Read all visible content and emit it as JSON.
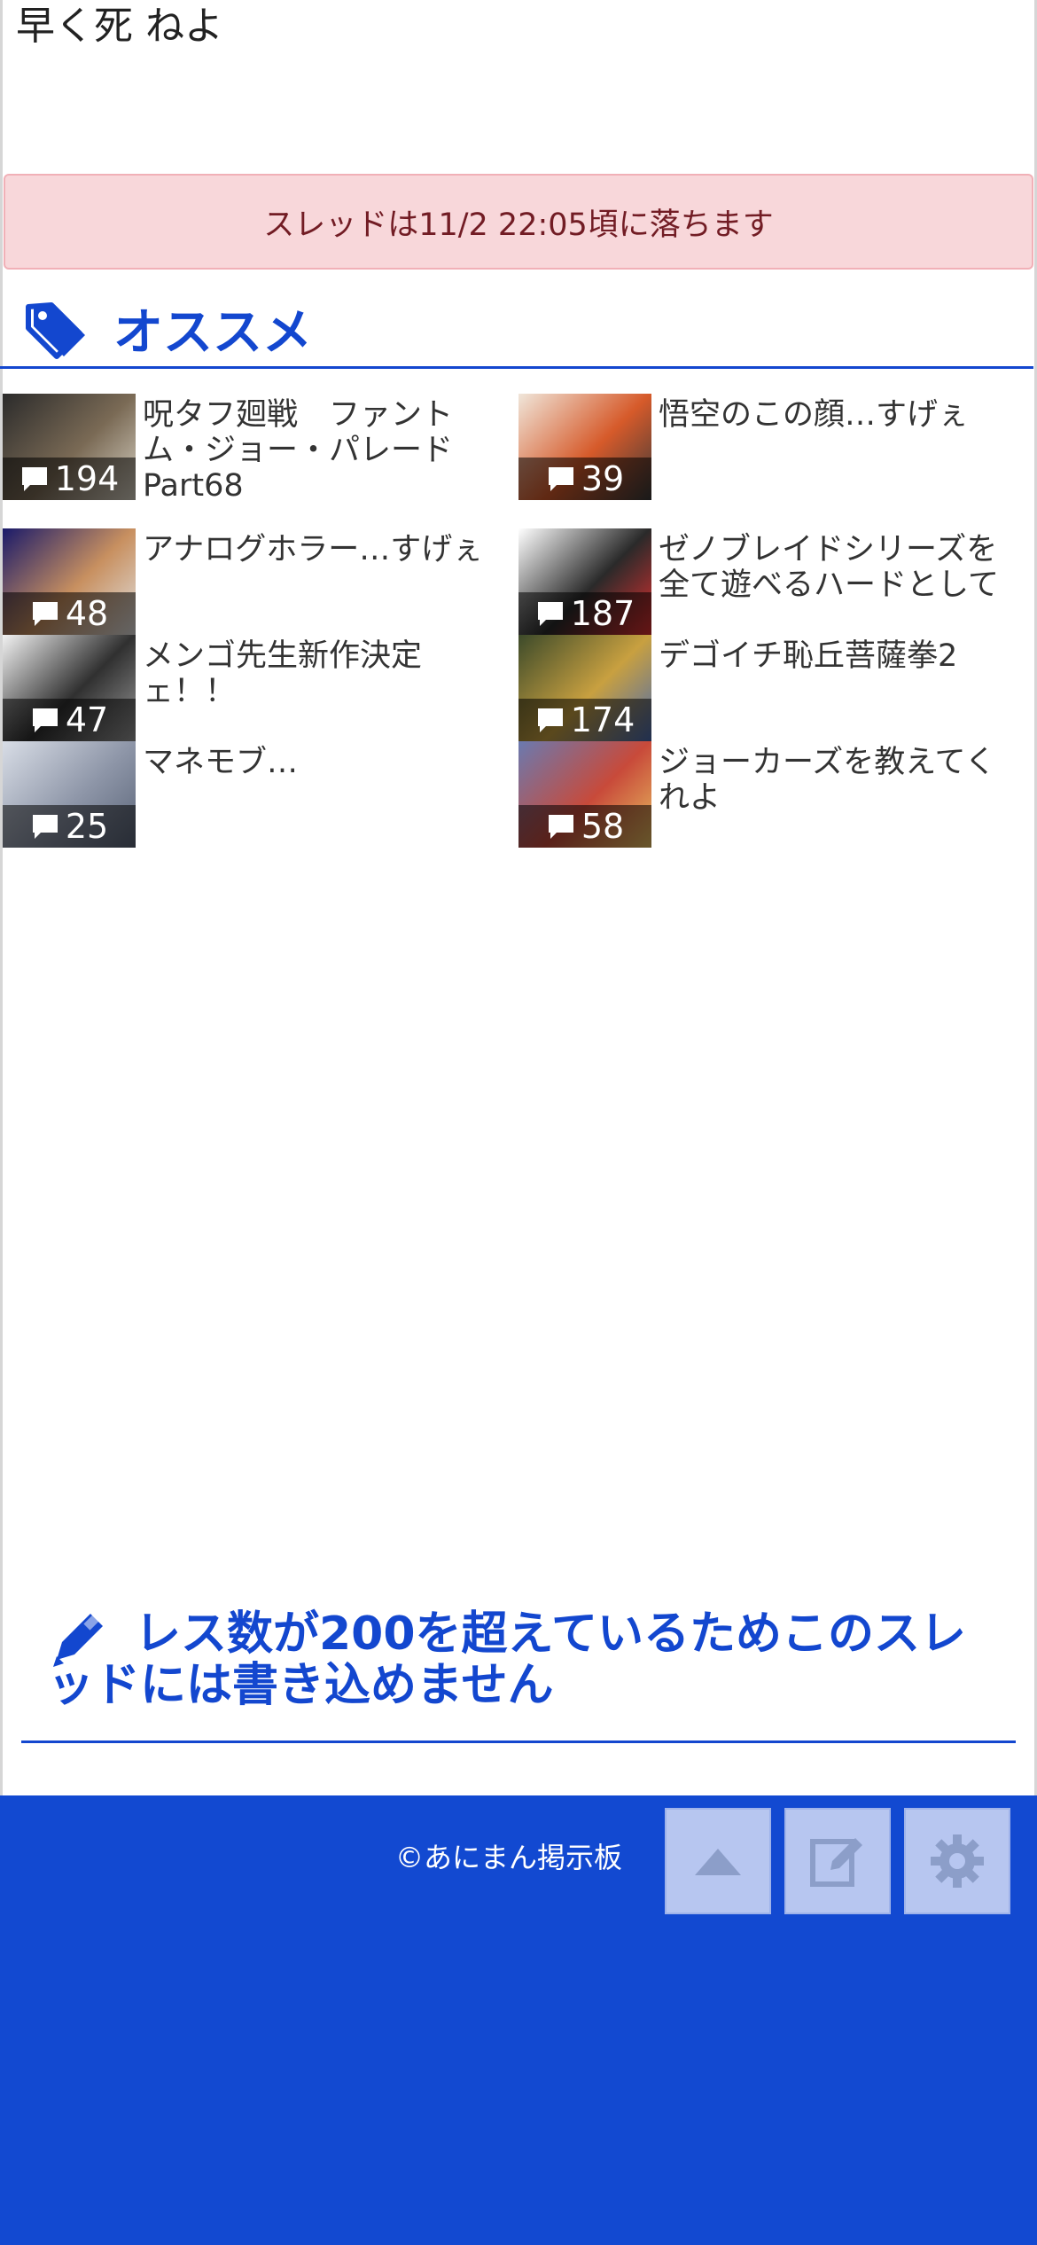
{
  "post": {
    "body": "早く死 ねよ"
  },
  "alert": {
    "text": "スレッドは11/2 22:05頃に落ちます"
  },
  "recommend": {
    "heading": "オススメ",
    "items": [
      {
        "title": "呪タフ廻戦　ファントム・ジョー・パレードPart68",
        "count": "194",
        "thumb_colors": [
          "#2b2b2b",
          "#7a6a55",
          "#d8d2c4"
        ]
      },
      {
        "title": "悟空のこの顔…すげぇ",
        "count": "39",
        "thumb_colors": [
          "#f0e6da",
          "#d65a2a",
          "#3a3a3a"
        ]
      },
      {
        "title": "アナログホラー…すげぇ",
        "count": "48",
        "thumb_colors": [
          "#1a1a6a",
          "#c89060",
          "#e0e0e0"
        ]
      },
      {
        "title": "ゼノブレイドシリーズを全て遊べるハードとして",
        "count": "187",
        "thumb_colors": [
          "#ffffff",
          "#2a2a2a",
          "#e23030"
        ]
      },
      {
        "title": "メンゴ先生新作決定ェ！！",
        "count": "47",
        "thumb_colors": [
          "#f2f2f2",
          "#303030",
          "#9a9a9a"
        ]
      },
      {
        "title": "デゴイチ恥丘菩薩拳2",
        "count": "174",
        "thumb_colors": [
          "#3c4a2a",
          "#c8a040",
          "#4a6ab0"
        ]
      },
      {
        "title": "マネモブ…",
        "count": "25",
        "thumb_colors": [
          "#d8dde6",
          "#8e96a8",
          "#5a6478"
        ]
      },
      {
        "title": "ジョーカーズを教えてくれよ",
        "count": "58",
        "thumb_colors": [
          "#6a7ab0",
          "#c84a3a",
          "#e8c060"
        ]
      }
    ]
  },
  "write_notice": {
    "text": "レス数が200を超えているためこのスレッドには書き込めません"
  },
  "footer": {
    "copyright": "©あにまん掲示板"
  },
  "colors": {
    "accent": "#1347cf",
    "footer_bg": "#1249d1",
    "alert_bg": "#f8d7da",
    "alert_text": "#721c24"
  }
}
